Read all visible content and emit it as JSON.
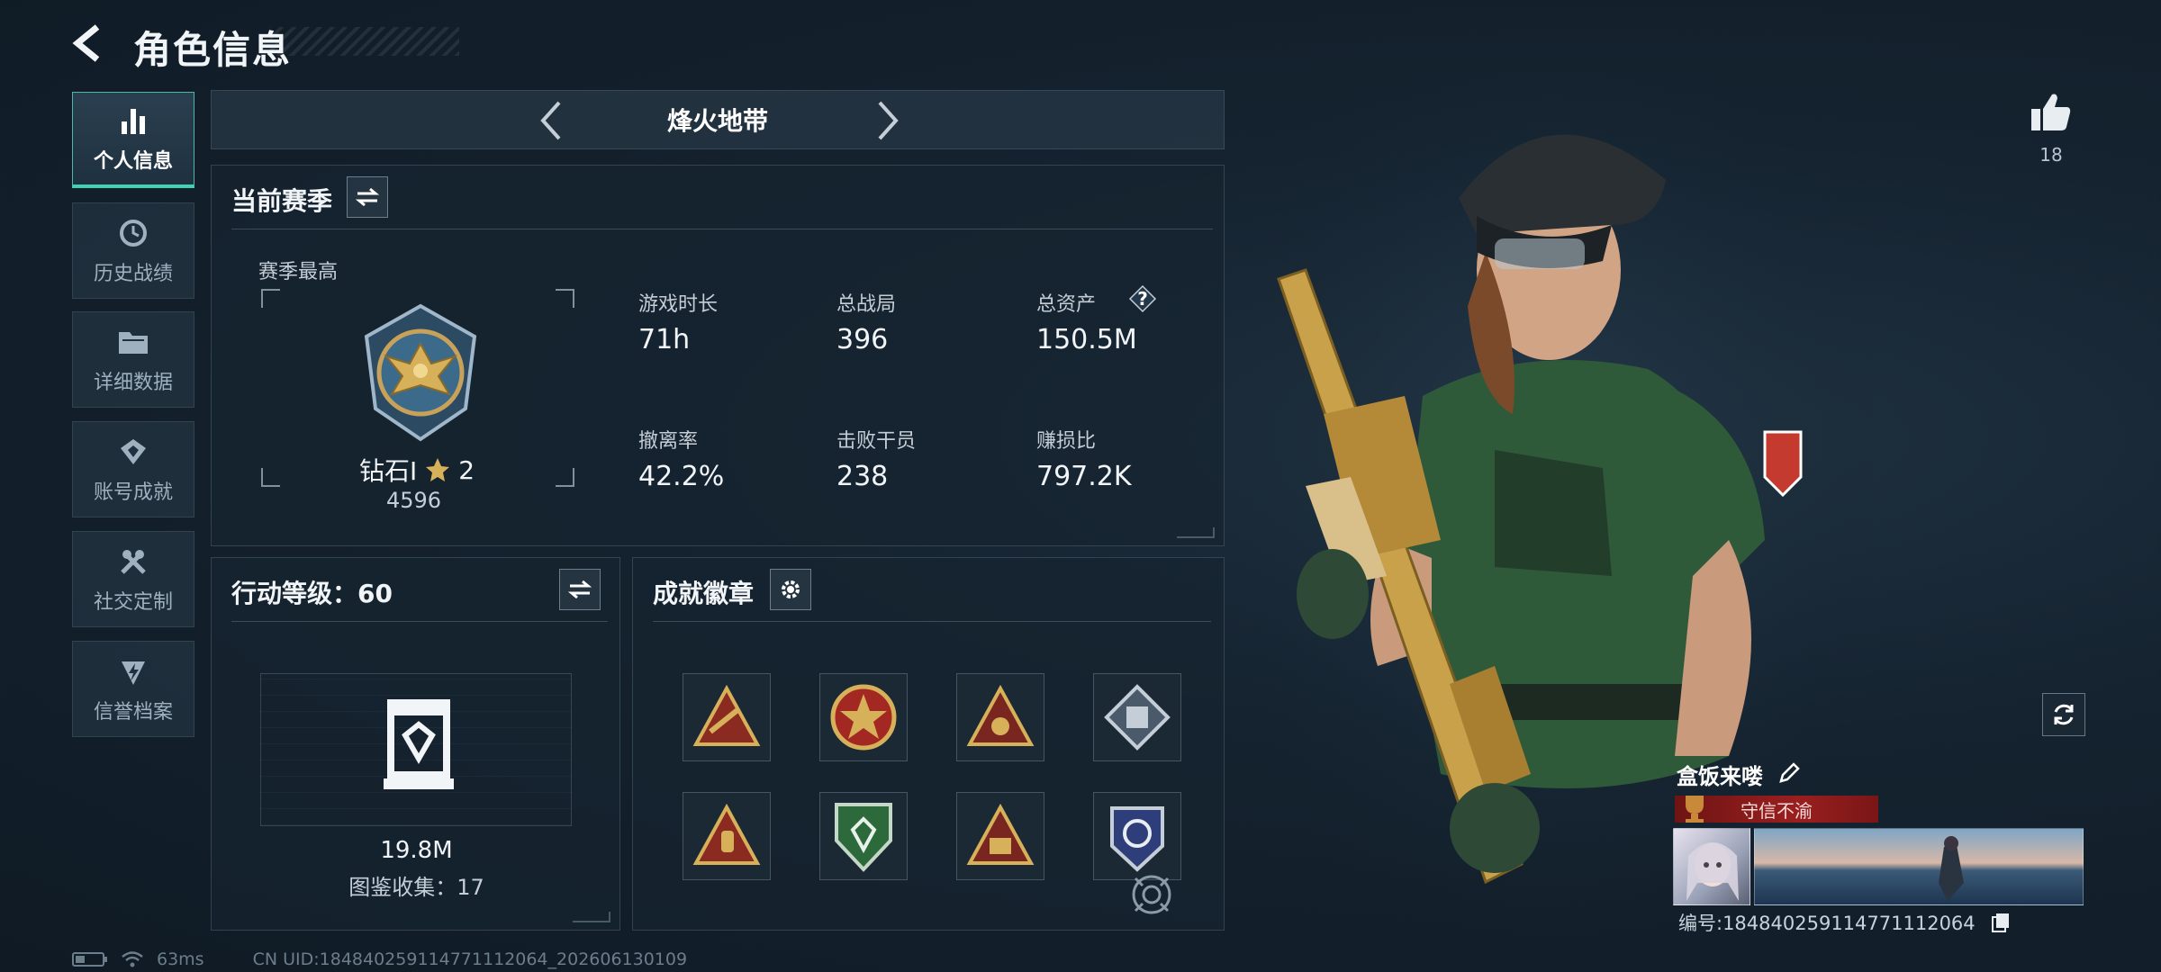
{
  "header": {
    "title": "角色信息"
  },
  "sidebar": {
    "items": [
      {
        "label": "个人信息",
        "icon": "bar-chart-icon",
        "active": true
      },
      {
        "label": "历史战绩",
        "icon": "history-clock-icon"
      },
      {
        "label": "详细数据",
        "icon": "folder-icon"
      },
      {
        "label": "账号成就",
        "icon": "achievement-icon"
      },
      {
        "label": "社交定制",
        "icon": "wrench-icon"
      },
      {
        "label": "信誉档案",
        "icon": "shield-bolt-icon"
      }
    ]
  },
  "mode_selector": {
    "name": "烽火地带"
  },
  "season": {
    "title": "当前赛季",
    "best_label": "赛季最高",
    "rank_name": "钻石I",
    "rank_stars": "2",
    "rank_score": "4596",
    "stats": [
      {
        "label": "游戏时长",
        "value": "71h"
      },
      {
        "label": "总战局",
        "value": "396"
      },
      {
        "label": "总资产",
        "value": "150.5M",
        "help": "?"
      },
      {
        "label": "撤离率",
        "value": "42.2%"
      },
      {
        "label": "击败干员",
        "value": "238"
      },
      {
        "label": "赚损比",
        "value": "797.2K"
      }
    ]
  },
  "action_level": {
    "title": "行动等级：60",
    "value": "19.8M",
    "collection": "图鉴收集：17"
  },
  "achievements": {
    "title": "成就徽章",
    "badges": [
      {
        "icon": "triangle-rifle-badge-icon"
      },
      {
        "icon": "star-medal-badge-icon"
      },
      {
        "icon": "triangle-emblem-badge-icon"
      },
      {
        "icon": "diamond-box-badge-icon"
      },
      {
        "icon": "triangle-hand-badge-icon"
      },
      {
        "icon": "green-shield-badge-icon"
      },
      {
        "icon": "triangle-gold-badge-icon"
      },
      {
        "icon": "blue-crest-badge-icon"
      }
    ]
  },
  "player": {
    "like_count": "18",
    "name": "盒饭来喽",
    "motto": "守信不渝",
    "uid_line": "编号:1848402591147711120​64"
  },
  "status": {
    "ping": "63ms",
    "uid": "CN UID:1848402591147711120​64_202606130109"
  },
  "colors": {
    "accent": "#3fd3b6",
    "motto_red": "#9a1f1f",
    "gold": "#d7b05a"
  }
}
